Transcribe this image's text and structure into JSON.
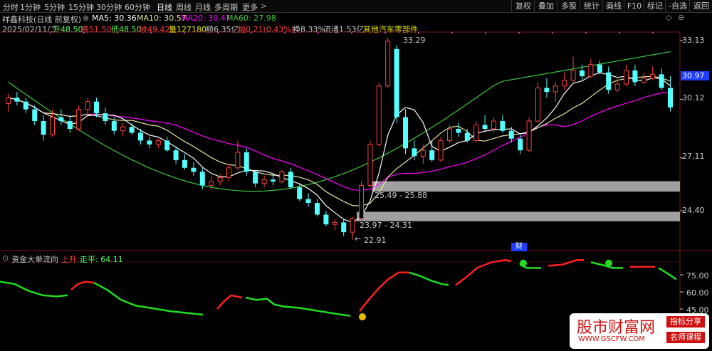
{
  "toolbar": {
    "periods": [
      "分时",
      "1分钟",
      "5分钟",
      "15分钟",
      "30分钟",
      "60分钟",
      "日线",
      "周线",
      "月线",
      "多周期",
      "更多"
    ],
    "buttons": [
      "复权",
      "叠加",
      "多股",
      "统计",
      "画线",
      "F10",
      "标记",
      "-自选",
      "返回"
    ]
  },
  "stock": {
    "title": "祥鑫科技(日线 前复权)",
    "ma5": "MA5: 30.36",
    "ma10": "MA10: 30.57",
    "ma20": "MA20: 30.47",
    "ma60": "MA60: 27.98",
    "date": "2025/02/11/二",
    "open": "开48.50",
    "high": "高51.50",
    "low": "低48.50",
    "close": "收49.42",
    "vol": "量127180",
    "amount": "额6.35亿",
    "change": "幅0.21(0.43%)",
    "turnover": "换8.33%",
    "float": "流通1.53亿",
    "sector": "其他汽车零部件"
  },
  "price_axis": {
    "ticks": [
      "33.13",
      "30.12",
      "27.11",
      "24.40"
    ],
    "current": "30.97"
  },
  "annotations": {
    "high": "33.29",
    "low": "22.91",
    "zone1": "25.49 - 25.88",
    "zone2": "23.97 - 24.31",
    "cai": "财"
  },
  "indicator": {
    "name": "资金大单流向",
    "up": "上升:",
    "flat": "走平: 64.11",
    "ticks": [
      "75.00",
      "60.00",
      "45.00"
    ]
  },
  "watermark": {
    "site": "股市财富网",
    "url": "WWW.GSCFW.COM",
    "tag1": "指标分享",
    "tag2": "名师课程"
  },
  "colors": {
    "up": "#ff4040",
    "down": "#54ffff",
    "ma5": "#ffffff",
    "ma10": "#e6e6a0",
    "ma20": "#ff00ff",
    "ma60": "#3cc83c"
  },
  "chart_data": {
    "type": "candlestick",
    "ylim": [
      22.0,
      34.0
    ],
    "candles": [
      [
        29.9,
        30.4,
        29.5,
        30.2
      ],
      [
        30.2,
        30.5,
        29.8,
        30.0
      ],
      [
        30.0,
        30.2,
        29.4,
        29.6
      ],
      [
        29.6,
        29.8,
        28.8,
        29.0
      ],
      [
        29.0,
        29.3,
        28.0,
        28.3
      ],
      [
        28.3,
        29.6,
        28.2,
        29.2
      ],
      [
        29.2,
        29.6,
        28.8,
        29.0
      ],
      [
        29.0,
        29.3,
        28.4,
        28.6
      ],
      [
        28.6,
        29.8,
        28.5,
        29.6
      ],
      [
        29.6,
        30.2,
        29.3,
        30.0
      ],
      [
        30.0,
        30.2,
        29.2,
        29.4
      ],
      [
        29.4,
        29.7,
        28.8,
        29.0
      ],
      [
        29.0,
        29.2,
        28.3,
        28.5
      ],
      [
        28.5,
        28.9,
        28.2,
        28.7
      ],
      [
        28.7,
        28.9,
        28.3,
        28.4
      ],
      [
        28.4,
        28.6,
        27.8,
        28.0
      ],
      [
        28.0,
        28.2,
        27.6,
        27.8
      ],
      [
        27.8,
        28.1,
        27.6,
        28.0
      ],
      [
        28.0,
        28.2,
        27.4,
        27.5
      ],
      [
        27.5,
        27.7,
        26.8,
        27.0
      ],
      [
        27.0,
        27.3,
        26.5,
        26.6
      ],
      [
        26.6,
        26.9,
        26.2,
        26.4
      ],
      [
        26.4,
        26.6,
        25.5,
        25.7
      ],
      [
        25.7,
        26.2,
        25.5,
        25.9
      ],
      [
        25.9,
        26.3,
        25.7,
        26.1
      ],
      [
        26.1,
        26.8,
        25.9,
        26.6
      ],
      [
        26.6,
        28.0,
        26.5,
        27.4
      ],
      [
        27.4,
        27.6,
        26.2,
        26.4
      ],
      [
        26.4,
        26.5,
        25.6,
        25.8
      ],
      [
        25.8,
        26.2,
        25.6,
        26.0
      ],
      [
        26.0,
        26.3,
        25.7,
        25.9
      ],
      [
        25.9,
        26.5,
        25.8,
        26.4
      ],
      [
        26.4,
        26.6,
        25.5,
        25.6
      ],
      [
        25.6,
        25.8,
        24.9,
        25.0
      ],
      [
        25.0,
        25.3,
        24.6,
        24.8
      ],
      [
        24.8,
        25.0,
        24.1,
        24.2
      ],
      [
        24.2,
        24.4,
        23.6,
        23.7
      ],
      [
        23.7,
        24.0,
        23.4,
        23.8
      ],
      [
        23.8,
        24.0,
        23.1,
        23.3
      ],
      [
        23.3,
        24.1,
        22.91,
        24.0
      ],
      [
        24.0,
        25.9,
        23.9,
        25.7
      ],
      [
        25.7,
        28.0,
        25.6,
        27.8
      ],
      [
        27.8,
        31.0,
        27.7,
        30.8
      ],
      [
        30.8,
        33.29,
        30.7,
        33.1
      ],
      [
        32.7,
        32.9,
        28.9,
        29.2
      ],
      [
        29.2,
        29.6,
        27.3,
        27.6
      ],
      [
        27.6,
        28.0,
        27.0,
        27.2
      ],
      [
        27.2,
        27.8,
        26.8,
        27.5
      ],
      [
        27.5,
        28.0,
        26.9,
        27.0
      ],
      [
        27.0,
        28.2,
        26.9,
        28.0
      ],
      [
        28.0,
        28.8,
        27.9,
        28.6
      ],
      [
        28.6,
        28.9,
        28.2,
        28.4
      ],
      [
        28.4,
        28.6,
        27.9,
        28.0
      ],
      [
        28.0,
        29.0,
        27.9,
        28.8
      ],
      [
        28.8,
        29.3,
        28.5,
        28.6
      ],
      [
        28.6,
        29.2,
        28.4,
        29.0
      ],
      [
        29.0,
        29.3,
        28.4,
        28.5
      ],
      [
        28.5,
        28.7,
        27.9,
        28.1
      ],
      [
        28.1,
        28.3,
        27.3,
        27.5
      ],
      [
        27.5,
        29.2,
        27.4,
        29.0
      ],
      [
        29.0,
        31.0,
        28.9,
        30.7
      ],
      [
        30.7,
        31.2,
        30.2,
        30.5
      ],
      [
        30.5,
        31.0,
        30.0,
        30.8
      ],
      [
        30.8,
        31.5,
        30.6,
        31.1
      ],
      [
        31.1,
        32.3,
        31.0,
        31.6
      ],
      [
        31.6,
        31.9,
        31.1,
        31.3
      ],
      [
        31.3,
        32.2,
        31.2,
        31.9
      ],
      [
        31.9,
        32.1,
        31.4,
        31.5
      ],
      [
        31.5,
        31.8,
        30.4,
        30.6
      ],
      [
        30.6,
        31.2,
        30.5,
        30.9
      ],
      [
        30.9,
        31.9,
        30.8,
        31.6
      ],
      [
        31.6,
        31.9,
        30.8,
        31.0
      ],
      [
        31.0,
        31.5,
        30.9,
        31.2
      ],
      [
        31.2,
        31.8,
        31.1,
        31.4
      ],
      [
        31.4,
        31.7,
        30.6,
        30.7
      ],
      [
        30.7,
        31.3,
        29.5,
        29.7
      ]
    ],
    "price_ticks": [
      33.13,
      30.12,
      27.11,
      24.4
    ],
    "zones": [
      [
        25.49,
        25.88
      ],
      [
        23.97,
        24.31
      ]
    ],
    "indicator": {
      "ylim": [
        38,
        80
      ]
    }
  }
}
